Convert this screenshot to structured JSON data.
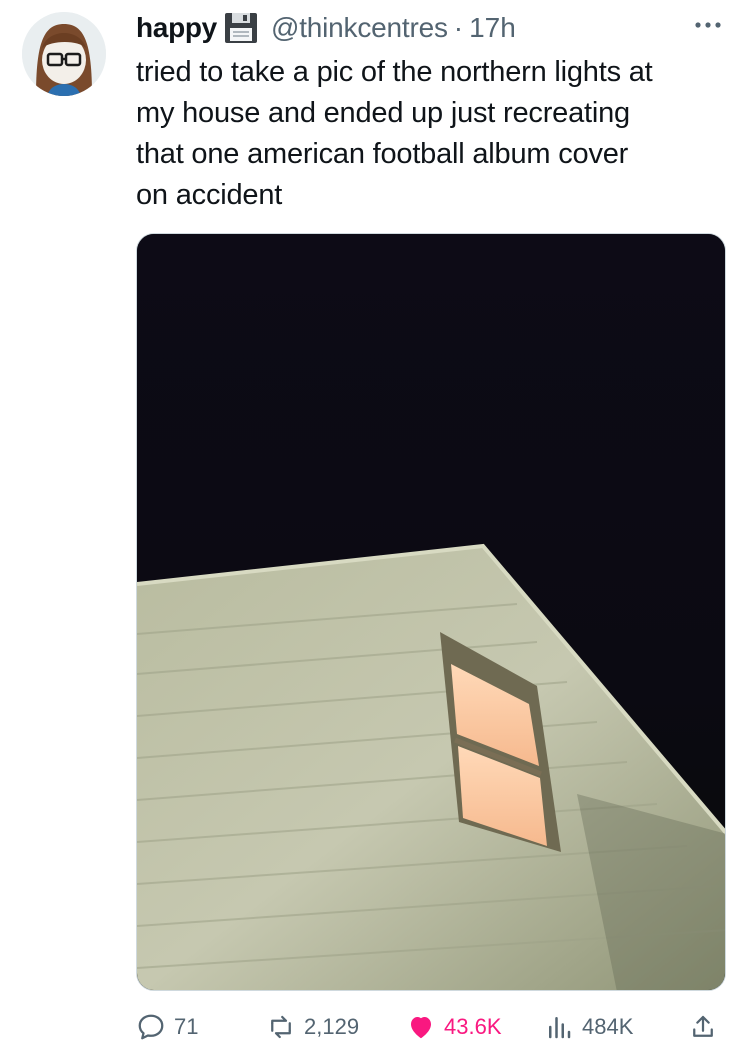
{
  "tweet": {
    "display_name": "happy",
    "handle": "@thinkcentres",
    "separator": "·",
    "time": "17h",
    "text": "tried to take a pic of the northern lights at\nmy house and ended up just recreating\nthat one american football album cover\non accident",
    "badge_icon": "floppy-disk-icon",
    "more_icon": "more-dots-icon"
  },
  "actions": {
    "replies": "71",
    "retweets": "2,129",
    "likes": "43.6K",
    "views": "484K",
    "like_color": "#f91880",
    "muted_color": "#536471"
  }
}
